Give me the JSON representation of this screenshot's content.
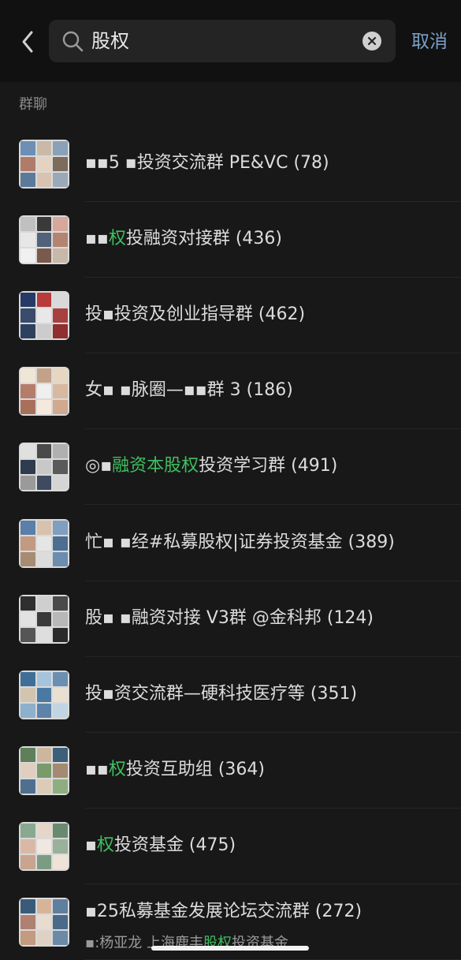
{
  "search": {
    "query": "股权",
    "cancel_label": "取消"
  },
  "section_title": "群聊",
  "results": [
    {
      "pre": "▪▪5 ▪",
      "hl": "",
      "post": "投资交流群 PE&VC (78)",
      "palette": [
        "#6b8fb5",
        "#c9b9a6",
        "#8aa2b8",
        "#b07b6a",
        "#e6d2c1",
        "#7d6b5c",
        "#5b7a99",
        "#d8c3b0",
        "#9aa9b8"
      ]
    },
    {
      "pre": "▪▪",
      "hl": "权",
      "post": "投融资对接群 (436)",
      "palette": [
        "#c0c0c0",
        "#3a3a3a",
        "#d6a79a",
        "#e7e7e7",
        "#51627a",
        "#b48473",
        "#f0f0f0",
        "#7a5a4a",
        "#c8b8a8"
      ]
    },
    {
      "pre": "投▪",
      "hl": "",
      "post": "投资及创业指导群 (462)",
      "palette": [
        "#263a66",
        "#b83a3a",
        "#d9d9d9",
        "#3a4b6b",
        "#e8e8e8",
        "#a84040",
        "#2e4060",
        "#cccccc",
        "#8f2f2f"
      ]
    },
    {
      "pre": "女▪ ▪",
      "hl": "",
      "post": "脉圈—▪▪群 3 (186)",
      "palette": [
        "#f0e6d6",
        "#c4a287",
        "#e8d7c0",
        "#b67c6a",
        "#efefef",
        "#d9b8a0",
        "#a8705a",
        "#f4e9dc",
        "#cfa990"
      ]
    },
    {
      "pre": "◎▪",
      "hl": "融资本股权",
      "post": "投资学习群 (491)",
      "palette": [
        "#e0e0e0",
        "#4a4a4a",
        "#b0b0b0",
        "#2f3b4f",
        "#c8c8c8",
        "#5a5a5a",
        "#9a9a9a",
        "#3d4a5f",
        "#d5d5d5"
      ]
    },
    {
      "pre": "忙▪ ▪",
      "hl": "",
      "post": "经#私募股权|证券投资基金 (389)",
      "palette": [
        "#5a7fa8",
        "#d9c2ad",
        "#7f9fbf",
        "#c29a80",
        "#e5e5e5",
        "#4d6e91",
        "#a78b72",
        "#dcdcdc",
        "#6a8db0"
      ]
    },
    {
      "pre": "股▪ ▪",
      "hl": "",
      "post": "融资对接 V3群 @金科邦 (124)",
      "palette": [
        "#2f2f2f",
        "#cfcfcf",
        "#4a4a4a",
        "#e2e2e2",
        "#3a3a3a",
        "#b8b8b8",
        "#555555",
        "#dedede",
        "#2a2a2a"
      ]
    },
    {
      "pre": "投▪",
      "hl": "",
      "post": "资交流群—硬科技医疗等 (351)",
      "palette": [
        "#3f6f99",
        "#a5c4dc",
        "#6b8fb0",
        "#d3c4b0",
        "#4a7aa3",
        "#e9e0d2",
        "#8db0cc",
        "#5d84a8",
        "#c1d4e3"
      ]
    },
    {
      "pre": "▪▪",
      "hl": "权",
      "post": "投资互助组 (364)",
      "palette": [
        "#5f7f5a",
        "#cdb69e",
        "#3e5f7a",
        "#e0cfbf",
        "#7a9a6a",
        "#a48a70",
        "#4f6f8f",
        "#dccbb8",
        "#8fae80"
      ]
    },
    {
      "pre": "▪",
      "hl": "权",
      "post": "投资基金 (475)",
      "palette": [
        "#8aa890",
        "#e6d6c8",
        "#6a8a70",
        "#d9b9a5",
        "#f0e8e0",
        "#9ab09a",
        "#c9a48e",
        "#7c9c82",
        "#efe3d6"
      ]
    },
    {
      "pre": "▪",
      "hl": "",
      "post": "25私募基金发展论坛交流群 (272)",
      "palette": [
        "#3a5a7a",
        "#d6b49a",
        "#5f7f9f",
        "#b08070",
        "#e8dccf",
        "#4a6a8a",
        "#c49a80",
        "#dfd2c4",
        "#6a8aa8"
      ],
      "sub_pre": "▪:杨亚龙 上海鹿丰",
      "sub_hl": "股权",
      "sub_post": "投资基金"
    }
  ],
  "colors": {
    "background": "#181818",
    "topbar": "#111111",
    "highlight": "#3fbf60",
    "cancel": "#7aa0c8"
  }
}
